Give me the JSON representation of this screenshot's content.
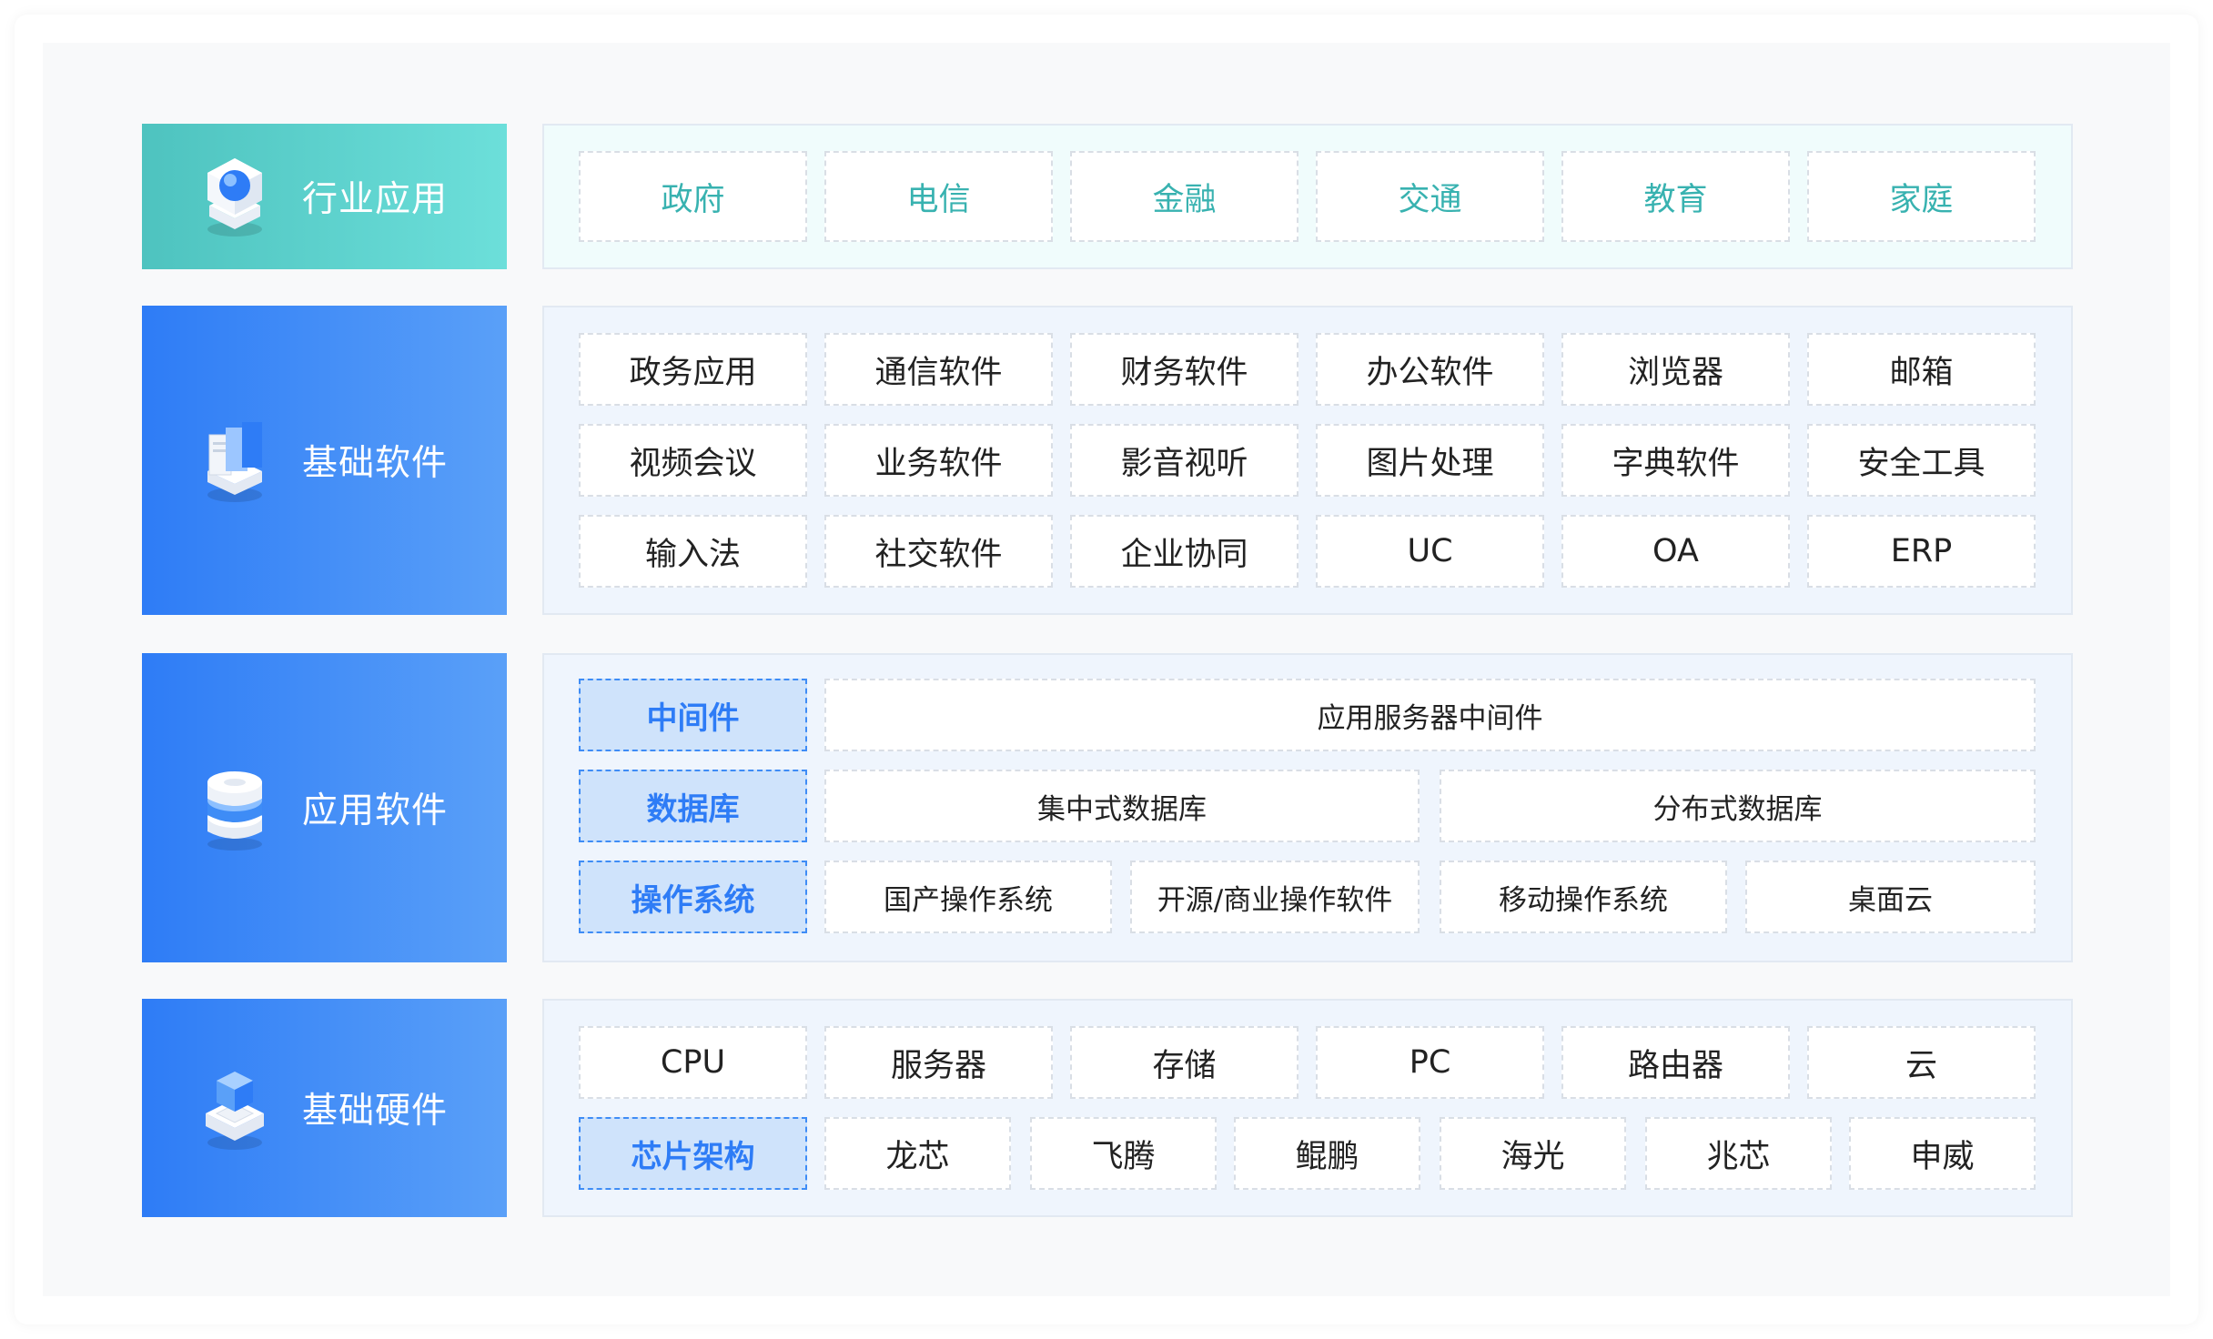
{
  "layers": {
    "industry": {
      "title": "行业应用",
      "items": [
        "政府",
        "电信",
        "金融",
        "交通",
        "教育",
        "家庭"
      ]
    },
    "base_software": {
      "title": "基础软件",
      "rows": [
        [
          "政务应用",
          "通信软件",
          "财务软件",
          "办公软件",
          "浏览器",
          "邮箱"
        ],
        [
          "视频会议",
          "业务软件",
          "影音视听",
          "图片处理",
          "字典软件",
          "安全工具"
        ],
        [
          "输入法",
          "社交软件",
          "企业协同",
          "UC",
          "OA",
          "ERP"
        ]
      ]
    },
    "app_software": {
      "title": "应用软件",
      "middleware": {
        "category": "中间件",
        "items": [
          "应用服务器中间件"
        ]
      },
      "database": {
        "category": "数据库",
        "items": [
          "集中式数据库",
          "分布式数据库"
        ]
      },
      "os": {
        "category": "操作系统",
        "items": [
          "国产操作系统",
          "开源/商业操作软件",
          "移动操作系统",
          "桌面云"
        ]
      }
    },
    "base_hardware": {
      "title": "基础硬件",
      "row1": [
        "CPU",
        "服务器",
        "存储",
        "PC",
        "路由器",
        "云"
      ],
      "chip": {
        "category": "芯片架构",
        "items": [
          "龙芯",
          "飞腾",
          "鲲鹏",
          "海光",
          "兆芯",
          "申威"
        ]
      }
    }
  },
  "icons": [
    "industry-cube-icon",
    "software-cards-icon",
    "app-cylinder-icon",
    "hardware-cube-icon"
  ],
  "colors": {
    "teal": "#4ec3bf",
    "blue": "#2e7cf6",
    "category_bg": "#cfe3fb",
    "teal_text": "#38b2b0"
  }
}
